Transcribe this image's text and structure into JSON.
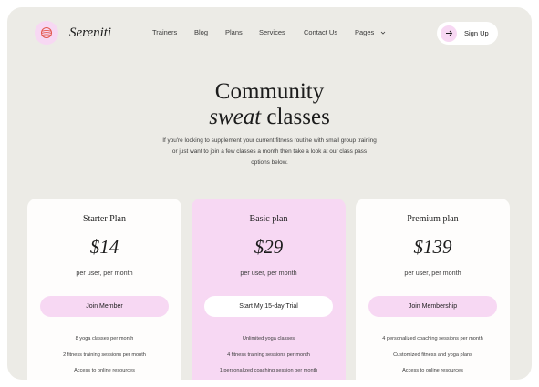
{
  "brand": {
    "name": "Sereniti",
    "logo_icon": "yarn-ball-icon",
    "accent": "#f7d8f3"
  },
  "nav": {
    "items": [
      "Trainers",
      "Blog",
      "Plans",
      "Services",
      "Contact Us",
      "Pages"
    ],
    "pages_icon": "chevron-down-icon"
  },
  "signup": {
    "label": "Sign Up",
    "icon": "arrow-right-icon"
  },
  "hero": {
    "title_line1": "Community",
    "title_italic": "sweat",
    "title_rest": " classes",
    "subtitle": "If you're looking to supplement your current fitness routine with small group training or just want to join a few classes a month then take a look at our class pass options below."
  },
  "plans": [
    {
      "name": "Starter Plan",
      "price": "$14",
      "per": "per user, per month",
      "button": "Join Member",
      "features": [
        "8 yoga classes per month",
        "2 fitness training sessions per month",
        "Access to online resources"
      ]
    },
    {
      "name": "Basic plan",
      "price": "$29",
      "per": "per user, per month",
      "button": "Start My 15-day Trial",
      "features": [
        "Unlimited yoga classes",
        "4 fitness training sessions per month",
        "1 personalized coaching session per month"
      ]
    },
    {
      "name": "Premium plan",
      "price": "$139",
      "per": "per user, per month",
      "button": "Join Membership",
      "features": [
        "4 personalized coaching sessions per month",
        "Customized fitness and yoga plans",
        "Access to online resources"
      ]
    }
  ]
}
